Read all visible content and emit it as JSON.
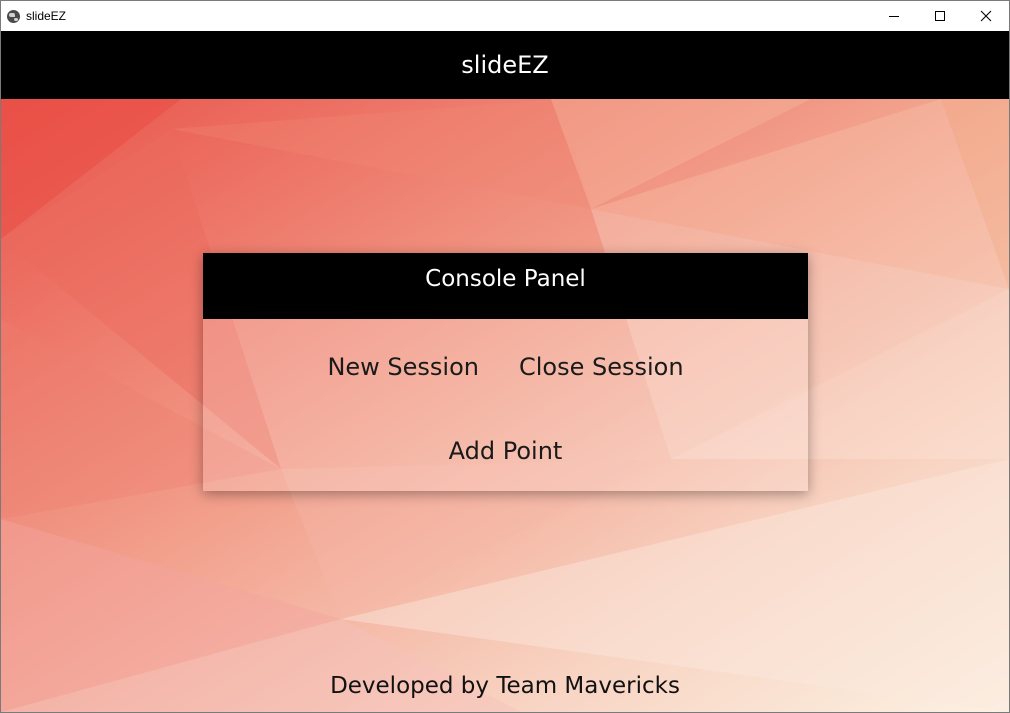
{
  "window": {
    "title": "slideEZ",
    "icon": "globe-icon",
    "controls": [
      "minimize-icon",
      "maximize-icon",
      "close-icon"
    ]
  },
  "app": {
    "header_title": "slideEZ"
  },
  "console_panel": {
    "title": "Console Panel",
    "buttons": {
      "new_session": "New Session",
      "close_session": "Close Session",
      "add_point": "Add Point"
    }
  },
  "footer": {
    "text": "Developed by Team Mavericks"
  },
  "colors": {
    "header_bg": "#000000",
    "header_text": "#ffffff",
    "background_gradient_start": "#e9534a",
    "background_gradient_end": "#fbefe3"
  }
}
